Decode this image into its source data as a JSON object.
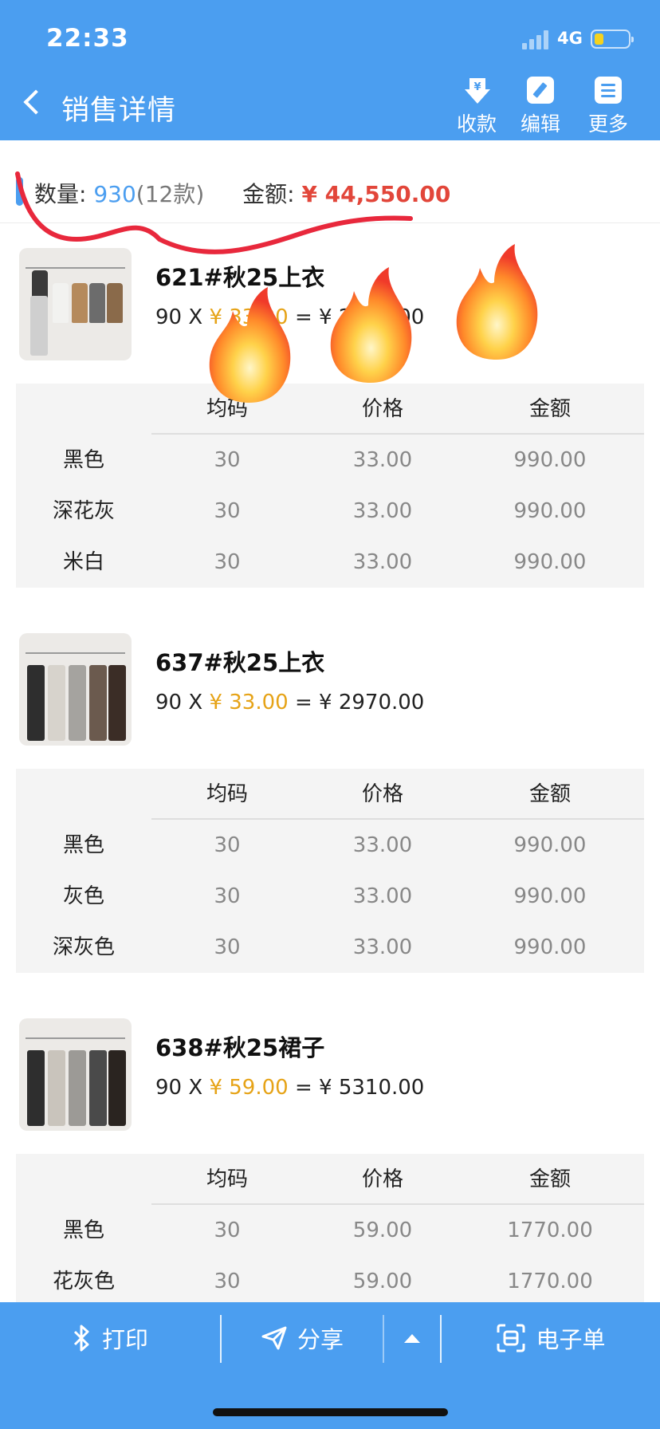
{
  "status_bar": {
    "time": "22:33",
    "network": "4G"
  },
  "header": {
    "title": "销售详情",
    "actions": [
      {
        "label": "收款",
        "icon": "yuan-download-icon"
      },
      {
        "label": "编辑",
        "icon": "pencil-icon"
      },
      {
        "label": "更多",
        "icon": "menu-list-icon"
      }
    ]
  },
  "summary": {
    "quantity_label": "数量:",
    "quantity_value": "930",
    "styles_count": "(12款)",
    "amount_label": "金额:",
    "amount_value": "¥ 44,550.00"
  },
  "table_headers": {
    "size": "均码",
    "price": "价格",
    "amount": "金额"
  },
  "products": [
    {
      "name": "621#秋25上衣",
      "qty": "90 X ",
      "unit_price": "¥ 33.00",
      "equals": " = ",
      "total": "¥ 2970.00",
      "rows": [
        {
          "color": "黑色",
          "size": "30",
          "price": "33.00",
          "amount": "990.00"
        },
        {
          "color": "深花灰",
          "size": "30",
          "price": "33.00",
          "amount": "990.00"
        },
        {
          "color": "米白",
          "size": "30",
          "price": "33.00",
          "amount": "990.00"
        }
      ]
    },
    {
      "name": "637#秋25上衣",
      "qty": "90 X ",
      "unit_price": "¥ 33.00",
      "equals": " = ",
      "total": "¥ 2970.00",
      "rows": [
        {
          "color": "黑色",
          "size": "30",
          "price": "33.00",
          "amount": "990.00"
        },
        {
          "color": "灰色",
          "size": "30",
          "price": "33.00",
          "amount": "990.00"
        },
        {
          "color": "深灰色",
          "size": "30",
          "price": "33.00",
          "amount": "990.00"
        }
      ]
    },
    {
      "name": "638#秋25裙子",
      "qty": "90 X ",
      "unit_price": "¥ 59.00",
      "equals": " = ",
      "total": "¥ 5310.00",
      "rows": [
        {
          "color": "黑色",
          "size": "30",
          "price": "59.00",
          "amount": "1770.00"
        },
        {
          "color": "花灰色",
          "size": "30",
          "price": "59.00",
          "amount": "1770.00"
        }
      ]
    }
  ],
  "bottom_bar": {
    "print": "打印",
    "share": "分享",
    "e_receipt": "电子单"
  },
  "colors": {
    "brand_blue": "#4b9ef0",
    "amount_red": "#e2463a",
    "price_orange": "#e6a317",
    "annotation_red": "#e8283c"
  }
}
